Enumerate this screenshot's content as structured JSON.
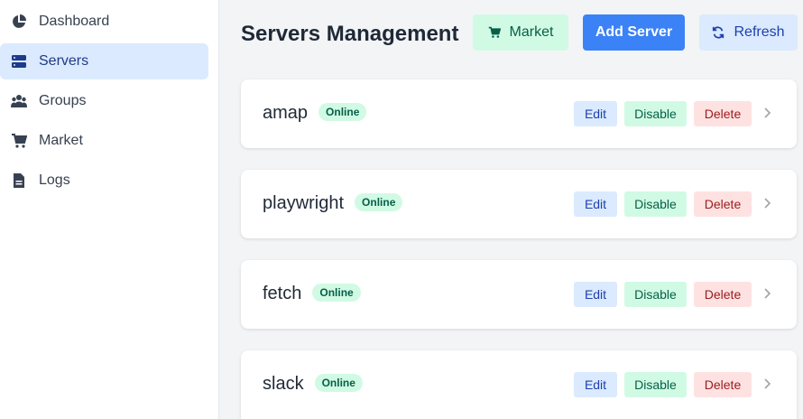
{
  "sidebar": {
    "items": [
      {
        "label": "Dashboard",
        "icon": "dashboard-icon"
      },
      {
        "label": "Servers",
        "icon": "server-icon",
        "active": true
      },
      {
        "label": "Groups",
        "icon": "groups-icon"
      },
      {
        "label": "Market",
        "icon": "cart-icon"
      },
      {
        "label": "Logs",
        "icon": "document-icon"
      }
    ]
  },
  "header": {
    "title": "Servers Management",
    "market_label": "Market",
    "add_label": "Add Server",
    "refresh_label": "Refresh"
  },
  "servers": [
    {
      "name": "amap",
      "status": "Online"
    },
    {
      "name": "playwright",
      "status": "Online"
    },
    {
      "name": "fetch",
      "status": "Online"
    },
    {
      "name": "slack",
      "status": "Online"
    }
  ],
  "actions": {
    "edit": "Edit",
    "disable": "Disable",
    "delete": "Delete"
  },
  "colors": {
    "accent": "#3b82f6",
    "active_nav_bg": "#dbeafe",
    "online_bg": "#d1fae5",
    "delete_bg": "#fee2e2"
  }
}
